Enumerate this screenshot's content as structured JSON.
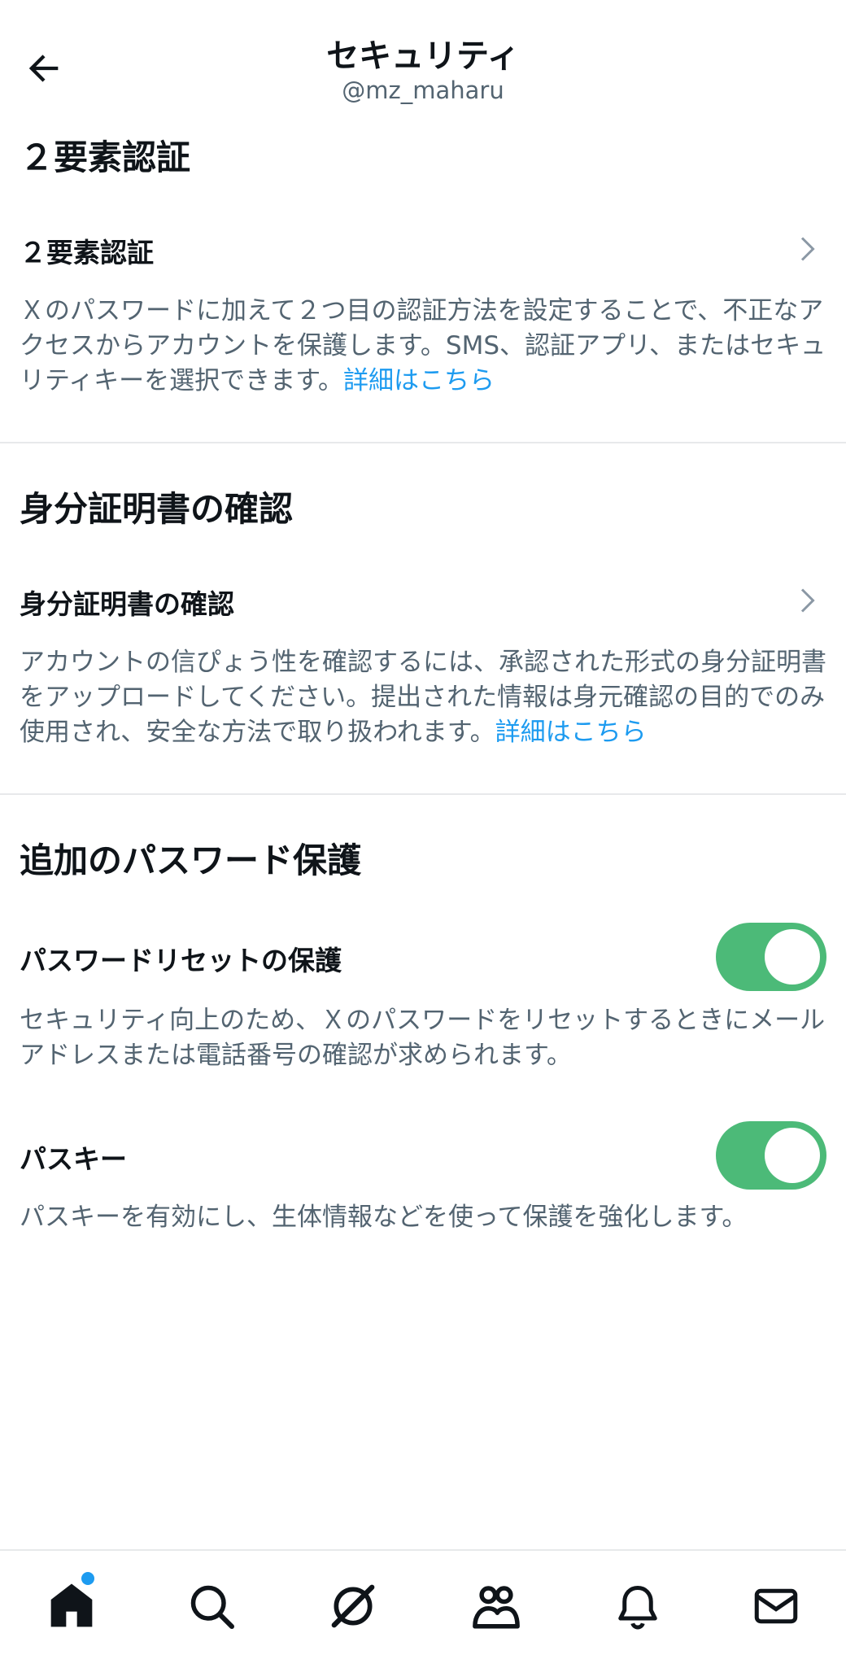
{
  "header": {
    "title": "セキュリティ",
    "subtitle": "@mz_maharu"
  },
  "sections": {
    "two_factor": {
      "heading": "２要素認証",
      "item_title": "２要素認証",
      "description": "Ｘのパスワードに加えて２つ目の認証方法を設定することで、不正なアクセスからアカウントを保護します。SMS、認証アプリ、またはセキュリティキーを選択できます。",
      "link": "詳細はこちら"
    },
    "id_verification": {
      "heading": "身分証明書の確認",
      "item_title": "身分証明書の確認",
      "description": "アカウントの信ぴょう性を確認するには、承認された形式の身分証明書をアップロードしてください。提出された情報は身元確認の目的でのみ使用され、安全な方法で取り扱われます。",
      "link": "詳細はこちら"
    },
    "password_protection": {
      "heading": "追加のパスワード保護",
      "reset_title": "パスワードリセットの保護",
      "reset_description": "セキュリティ向上のため、Ｘのパスワードをリセットするときにメールアドレスまたは電話番号の確認が求められます。",
      "reset_enabled": true,
      "passkey_title": "パスキー",
      "passkey_description": "パスキーを有効にし、生体情報などを使って保護を強化します。",
      "passkey_enabled": true
    }
  },
  "tabbar": {
    "icons": [
      "home-icon",
      "search-icon",
      "grok-icon",
      "communities-icon",
      "notifications-icon",
      "messages-icon"
    ],
    "home_has_badge": true
  },
  "colors": {
    "accent": "#1d9bf0",
    "toggle_on": "#4cba78",
    "text_primary": "#0f1419",
    "text_secondary": "#536471"
  }
}
